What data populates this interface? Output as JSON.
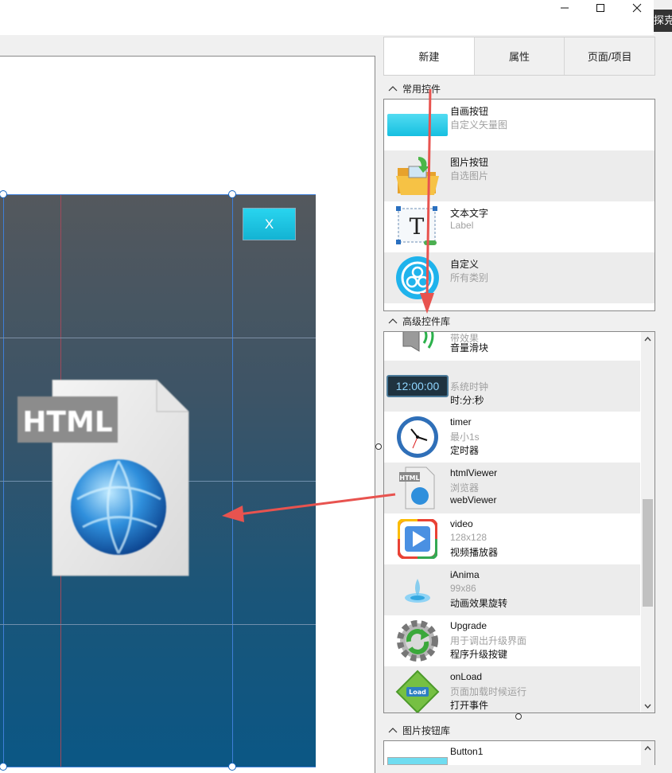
{
  "window": {
    "minimize_glyph": "—",
    "maximize_glyph": "☐",
    "close_glyph": "✕",
    "edge_text": "探克"
  },
  "canvas": {
    "close_button_label": "X",
    "html_icon_text": "HTML"
  },
  "panel": {
    "tabs": [
      {
        "label": "新建",
        "active": true
      },
      {
        "label": "属性",
        "active": false
      },
      {
        "label": "页面/项目",
        "active": false
      }
    ],
    "sections": {
      "common": {
        "title": "常用控件",
        "items": [
          {
            "name": "自画按钮",
            "desc": "自定义矢量图",
            "icon": "cyan-button-icon"
          },
          {
            "name": "图片按钮",
            "desc": "自选图片",
            "icon": "folder-image-icon"
          },
          {
            "name": "文本文字",
            "desc": "Label",
            "icon": "text-label-icon"
          },
          {
            "name": "自定义",
            "desc": "所有类别",
            "icon": "custom-hexagon-icon"
          }
        ]
      },
      "advanced": {
        "title": "高级控件库",
        "items": [
          {
            "partial": "带效果",
            "name": "音量滑块",
            "icon": "volume-slider-icon"
          },
          {
            "name": "",
            "desc": "系统时钟",
            "detail": "时:分:秒",
            "icon": "clock-display-icon",
            "clock_text": "12:00:00"
          },
          {
            "name": "timer",
            "desc": "最小1s",
            "detail": "定时器",
            "icon": "clock-icon"
          },
          {
            "name": "htmlViewer",
            "desc": "浏览器",
            "detail": "webViewer",
            "icon": "html-file-icon"
          },
          {
            "name": "video",
            "desc": "128x128",
            "detail": "视频播放器",
            "icon": "video-play-icon"
          },
          {
            "name": "iAnima",
            "desc": "99x86",
            "detail": "动画效果旋转",
            "icon": "animation-icon"
          },
          {
            "name": "Upgrade",
            "desc": "用于调出升级界面",
            "detail": "程序升级按键",
            "icon": "upgrade-gear-icon"
          },
          {
            "name": "onLoad",
            "desc": "页面加载时候运行",
            "detail": "打开事件",
            "icon": "onload-icon"
          }
        ]
      },
      "image_buttons": {
        "title": "图片按钮库",
        "items": [
          {
            "name": "Button1",
            "icon": "cyan-button-icon"
          }
        ]
      }
    }
  },
  "colors": {
    "accent_cyan": "#1ec6e6",
    "arrow_red": "#e8534f",
    "selection_blue": "#1565c0"
  }
}
